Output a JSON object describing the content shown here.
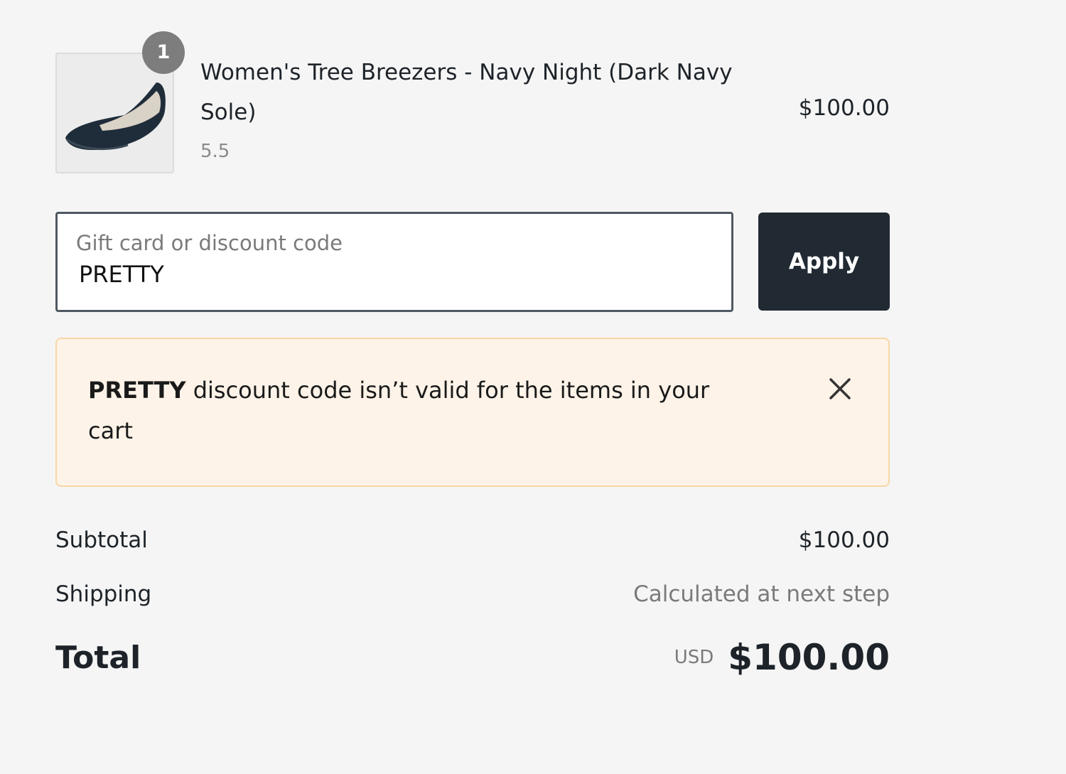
{
  "line_item": {
    "quantity": "1",
    "name": "Women's Tree Breezers - Navy Night (Dark Navy Sole)",
    "variant": "5.5",
    "price": "$100.00",
    "image_icon": "shoe-icon"
  },
  "discount": {
    "label": "Gift card or discount code",
    "value": "PRETTY",
    "apply_label": "Apply"
  },
  "notice": {
    "code": "PRETTY",
    "message": " discount code isn’t valid for the items in your cart",
    "close_icon": "close-icon",
    "background": "#fdf3e8",
    "border": "#f7d7a6"
  },
  "totals": {
    "subtotal_label": "Subtotal",
    "subtotal_value": "$100.00",
    "shipping_label": "Shipping",
    "shipping_value": "Calculated at next step",
    "total_label": "Total",
    "currency": "USD",
    "total_value": "$100.00"
  },
  "colors": {
    "button": "#212a33",
    "badge": "#7d7d7d"
  }
}
